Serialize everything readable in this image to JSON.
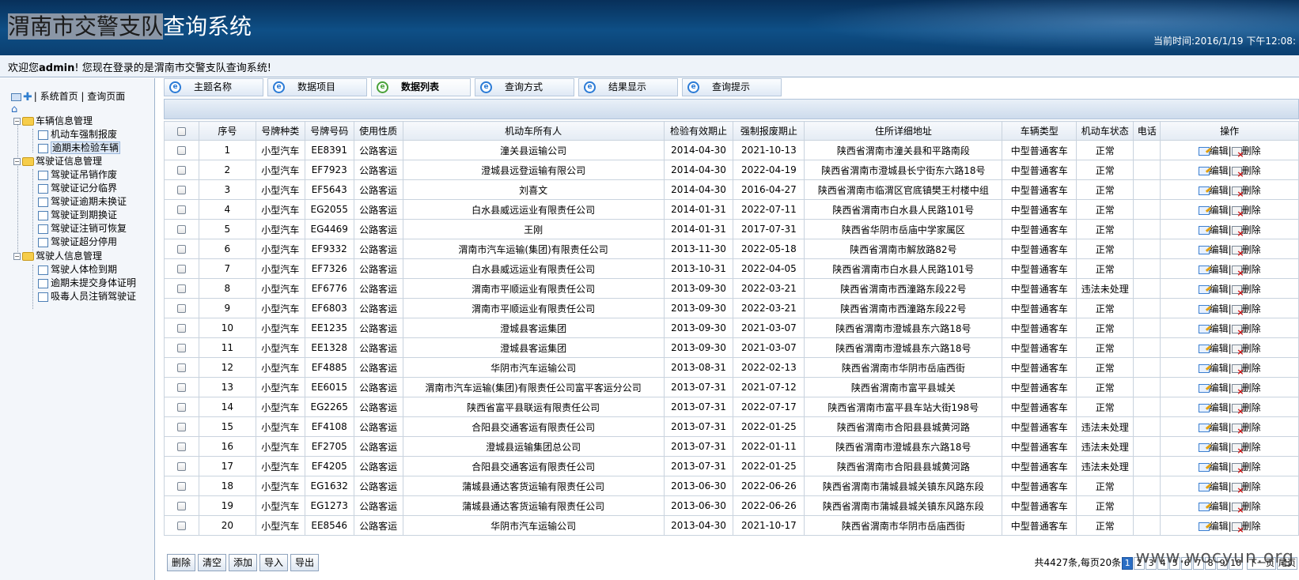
{
  "header": {
    "title_highlight": "渭南市交警支队",
    "title_rest": "查询系统",
    "clock_label": "当前时间:",
    "clock_value": "2016/1/19 下午12:08:"
  },
  "welcome": {
    "prefix": "欢迎您",
    "user": "admin",
    "suffix": "! 您现在登录的是渭南市交警支队查询系统!"
  },
  "sidebar": {
    "links": "| 系统首页 | 查询页面",
    "groups": [
      {
        "label": "车辆信息管理",
        "items": [
          "机动车强制报废",
          "逾期未检验车辆"
        ]
      },
      {
        "label": "驾驶证信息管理",
        "items": [
          "驾驶证吊销作废",
          "驾驶证记分临界",
          "驾驶证逾期未换证",
          "驾驶证到期换证",
          "驾驶证注销可恢复",
          "驾驶证超分停用"
        ]
      },
      {
        "label": "驾驶人信息管理",
        "items": [
          "驾驶人体检到期",
          "逾期未提交身体证明",
          "吸毒人员注销驾驶证"
        ]
      }
    ]
  },
  "tabs": [
    "主题名称",
    "数据项目",
    "数据列表",
    "查询方式",
    "结果显示",
    "查询提示"
  ],
  "table": {
    "headers": [
      "序号",
      "号牌种类",
      "号牌号码",
      "使用性质",
      "机动车所有人",
      "检验有效期止",
      "强制报废期止",
      "住所详细地址",
      "车辆类型",
      "机动车状态",
      "电话",
      "操作"
    ],
    "edit_label": "编辑",
    "sep": "|",
    "delete_label": "删除",
    "rows": [
      [
        "1",
        "小型汽车",
        "EE8391",
        "公路客运",
        "潼关县运输公司",
        "2014-04-30",
        "2021-10-13",
        "陕西省渭南市潼关县和平路南段",
        "中型普通客车",
        "正常",
        ""
      ],
      [
        "2",
        "小型汽车",
        "EF7923",
        "公路客运",
        "澄城县远登运输有限公司",
        "2014-04-30",
        "2022-04-19",
        "陕西省渭南市澄城县长宁街东六路18号",
        "中型普通客车",
        "正常",
        ""
      ],
      [
        "3",
        "小型汽车",
        "EF5643",
        "公路客运",
        "刘喜文",
        "2014-04-30",
        "2016-04-27",
        "陕西省渭南市临渭区官底镇樊王村楼中组",
        "中型普通客车",
        "正常",
        ""
      ],
      [
        "4",
        "小型汽车",
        "EG2055",
        "公路客运",
        "白水县威远运业有限责任公司",
        "2014-01-31",
        "2022-07-11",
        "陕西省渭南市白水县人民路101号",
        "中型普通客车",
        "正常",
        ""
      ],
      [
        "5",
        "小型汽车",
        "EG4469",
        "公路客运",
        "王刚",
        "2014-01-31",
        "2017-07-31",
        "陕西省华阴市岳庙中学家属区",
        "中型普通客车",
        "正常",
        ""
      ],
      [
        "6",
        "小型汽车",
        "EF9332",
        "公路客运",
        "渭南市汽车运输(集团)有限责任公司",
        "2013-11-30",
        "2022-05-18",
        "陕西省渭南市解放路82号",
        "中型普通客车",
        "正常",
        ""
      ],
      [
        "7",
        "小型汽车",
        "EF7326",
        "公路客运",
        "白水县威远运业有限责任公司",
        "2013-10-31",
        "2022-04-05",
        "陕西省渭南市白水县人民路101号",
        "中型普通客车",
        "正常",
        ""
      ],
      [
        "8",
        "小型汽车",
        "EF6776",
        "公路客运",
        "渭南市平顺运业有限责任公司",
        "2013-09-30",
        "2022-03-21",
        "陕西省渭南市西潼路东段22号",
        "中型普通客车",
        "违法未处理",
        ""
      ],
      [
        "9",
        "小型汽车",
        "EF6803",
        "公路客运",
        "渭南市平顺运业有限责任公司",
        "2013-09-30",
        "2022-03-21",
        "陕西省渭南市西潼路东段22号",
        "中型普通客车",
        "正常",
        ""
      ],
      [
        "10",
        "小型汽车",
        "EE1235",
        "公路客运",
        "澄城县客运集团",
        "2013-09-30",
        "2021-03-07",
        "陕西省渭南市澄城县东六路18号",
        "中型普通客车",
        "正常",
        ""
      ],
      [
        "11",
        "小型汽车",
        "EE1328",
        "公路客运",
        "澄城县客运集团",
        "2013-09-30",
        "2021-03-07",
        "陕西省渭南市澄城县东六路18号",
        "中型普通客车",
        "正常",
        ""
      ],
      [
        "12",
        "小型汽车",
        "EF4885",
        "公路客运",
        "华阴市汽车运输公司",
        "2013-08-31",
        "2022-02-13",
        "陕西省渭南市华阴市岳庙西街",
        "中型普通客车",
        "正常",
        ""
      ],
      [
        "13",
        "小型汽车",
        "EE6015",
        "公路客运",
        "渭南市汽车运输(集团)有限责任公司富平客运分公司",
        "2013-07-31",
        "2021-07-12",
        "陕西省渭南市富平县城关",
        "中型普通客车",
        "正常",
        ""
      ],
      [
        "14",
        "小型汽车",
        "EG2265",
        "公路客运",
        "陕西省富平县联运有限责任公司",
        "2013-07-31",
        "2022-07-17",
        "陕西省渭南市富平县车站大街198号",
        "中型普通客车",
        "正常",
        ""
      ],
      [
        "15",
        "小型汽车",
        "EF4108",
        "公路客运",
        "合阳县交通客运有限责任公司",
        "2013-07-31",
        "2022-01-25",
        "陕西省渭南市合阳县县城黄河路",
        "中型普通客车",
        "违法未处理",
        ""
      ],
      [
        "16",
        "小型汽车",
        "EF2705",
        "公路客运",
        "澄城县运输集团总公司",
        "2013-07-31",
        "2022-01-11",
        "陕西省渭南市澄城县东六路18号",
        "中型普通客车",
        "违法未处理",
        ""
      ],
      [
        "17",
        "小型汽车",
        "EF4205",
        "公路客运",
        "合阳县交通客运有限责任公司",
        "2013-07-31",
        "2022-01-25",
        "陕西省渭南市合阳县县城黄河路",
        "中型普通客车",
        "违法未处理",
        ""
      ],
      [
        "18",
        "小型汽车",
        "EG1632",
        "公路客运",
        "蒲城县通达客货运输有限责任公司",
        "2013-06-30",
        "2022-06-26",
        "陕西省渭南市蒲城县城关镇东风路东段",
        "中型普通客车",
        "正常",
        ""
      ],
      [
        "19",
        "小型汽车",
        "EG1273",
        "公路客运",
        "蒲城县通达客货运输有限责任公司",
        "2013-06-30",
        "2022-06-26",
        "陕西省渭南市蒲城县城关镇东风路东段",
        "中型普通客车",
        "正常",
        ""
      ],
      [
        "20",
        "小型汽车",
        "EE8546",
        "公路客运",
        "华阴市汽车运输公司",
        "2013-04-30",
        "2021-10-17",
        "陕西省渭南市华阴市岳庙西街",
        "中型普通客车",
        "正常",
        ""
      ]
    ]
  },
  "toolbar": {
    "buttons": [
      "删除",
      "清空",
      "添加",
      "导入",
      "导出"
    ]
  },
  "pager": {
    "summary": "共4427条,每页20条",
    "current": "1",
    "pages": [
      "1",
      "2",
      "3",
      "4",
      "5",
      "6",
      "7",
      "8",
      "9",
      "10"
    ],
    "next_label": "下一页",
    "last_label": "尾页"
  },
  "watermark": "www.wocyun.org",
  "colors": {
    "header_bg": "#0e4f86",
    "current_page": "#2a6ec4",
    "delete_mark": "#d01010"
  }
}
